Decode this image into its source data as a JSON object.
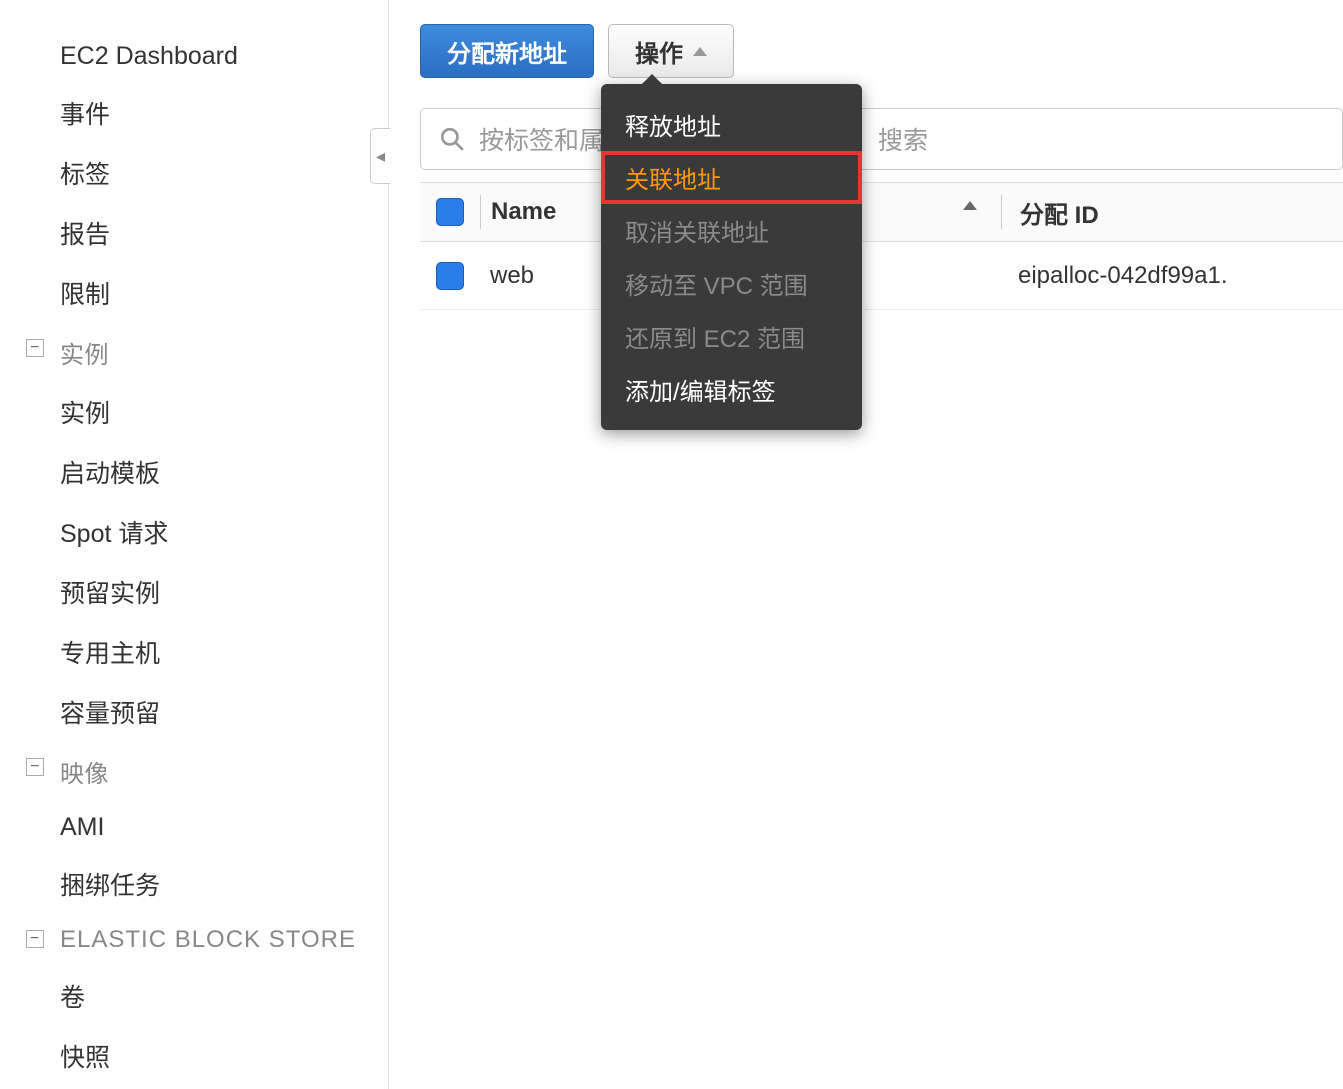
{
  "sidebar": {
    "items_top": [
      "EC2 Dashboard",
      "事件",
      "标签",
      "报告",
      "限制"
    ],
    "section_instances": {
      "label": "实例",
      "items": [
        "实例",
        "启动模板",
        "Spot 请求",
        "预留实例",
        "专用主机",
        "容量预留"
      ]
    },
    "section_images": {
      "label": "映像",
      "items": [
        "AMI",
        "捆绑任务"
      ]
    },
    "section_ebs": {
      "label": "ELASTIC BLOCK STORE",
      "items": [
        "卷",
        "快照"
      ]
    }
  },
  "toolbar": {
    "allocate_new": "分配新地址",
    "actions": "操作"
  },
  "search": {
    "placeholder_prefix": "按标签和属",
    "placeholder_suffix": "搜索"
  },
  "table": {
    "columns": {
      "name": "Name",
      "allocation_id": "分配 ID"
    },
    "rows": [
      {
        "name": "web",
        "allocation_id": "eipalloc-042df99a1."
      }
    ]
  },
  "dropdown": {
    "items": [
      {
        "label": "释放地址",
        "state": "enabled"
      },
      {
        "label": "关联地址",
        "state": "highlight"
      },
      {
        "label": "取消关联地址",
        "state": "disabled"
      },
      {
        "label": "移动至 VPC 范围",
        "state": "disabled"
      },
      {
        "label": "还原到 EC2 范围",
        "state": "disabled"
      },
      {
        "label": "添加/编辑标签",
        "state": "enabled"
      }
    ]
  },
  "collapse_glyph": "−",
  "caret_left": "◂"
}
